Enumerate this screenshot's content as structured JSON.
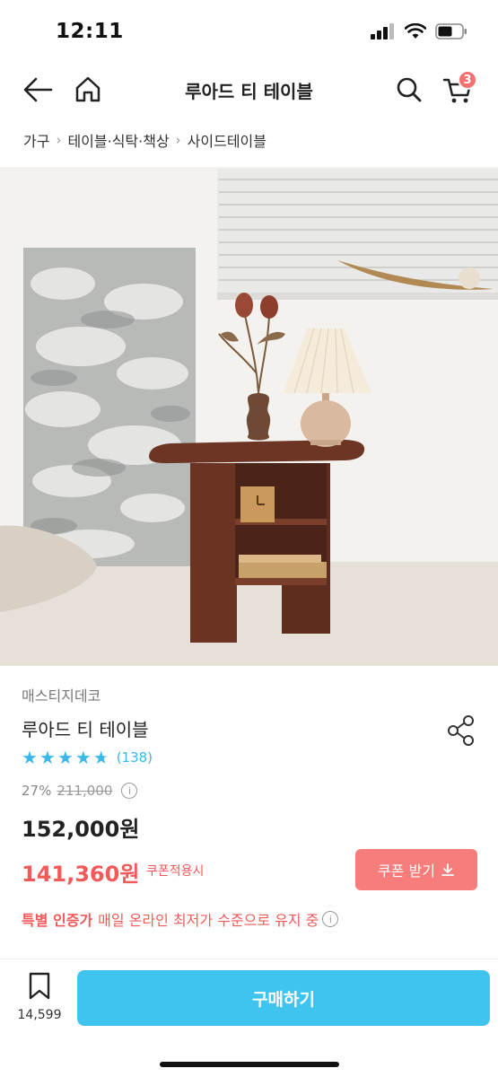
{
  "status_bar": {
    "time": "12:11"
  },
  "header": {
    "title": "루아드 티 테이블",
    "cart_count": "3"
  },
  "breadcrumb": [
    "가구",
    "테이블·식탁·책상",
    "사이드테이블"
  ],
  "product": {
    "brand": "매스티지데코",
    "name": "루아드 티 테이블",
    "rating": 4.7,
    "review_count": "(138)",
    "discount_rate": "27%",
    "original_price": "211,000",
    "sale_price": "152,000원",
    "coupon_price": "141,360원",
    "coupon_applied_label": "쿠폰적용시",
    "coupon_button_label": "쿠폰 받기",
    "cert_label": "특별 인증가",
    "cert_text": "매일 온라인 최저가 수준으로 유지 중"
  },
  "bottom_bar": {
    "wish_count": "14,599",
    "buy_label": "구매하기"
  },
  "colors": {
    "accent": "#3fc3ef",
    "price_red": "#f25a5a",
    "coupon_button": "#f77d7d",
    "star": "#3ab8ea"
  }
}
